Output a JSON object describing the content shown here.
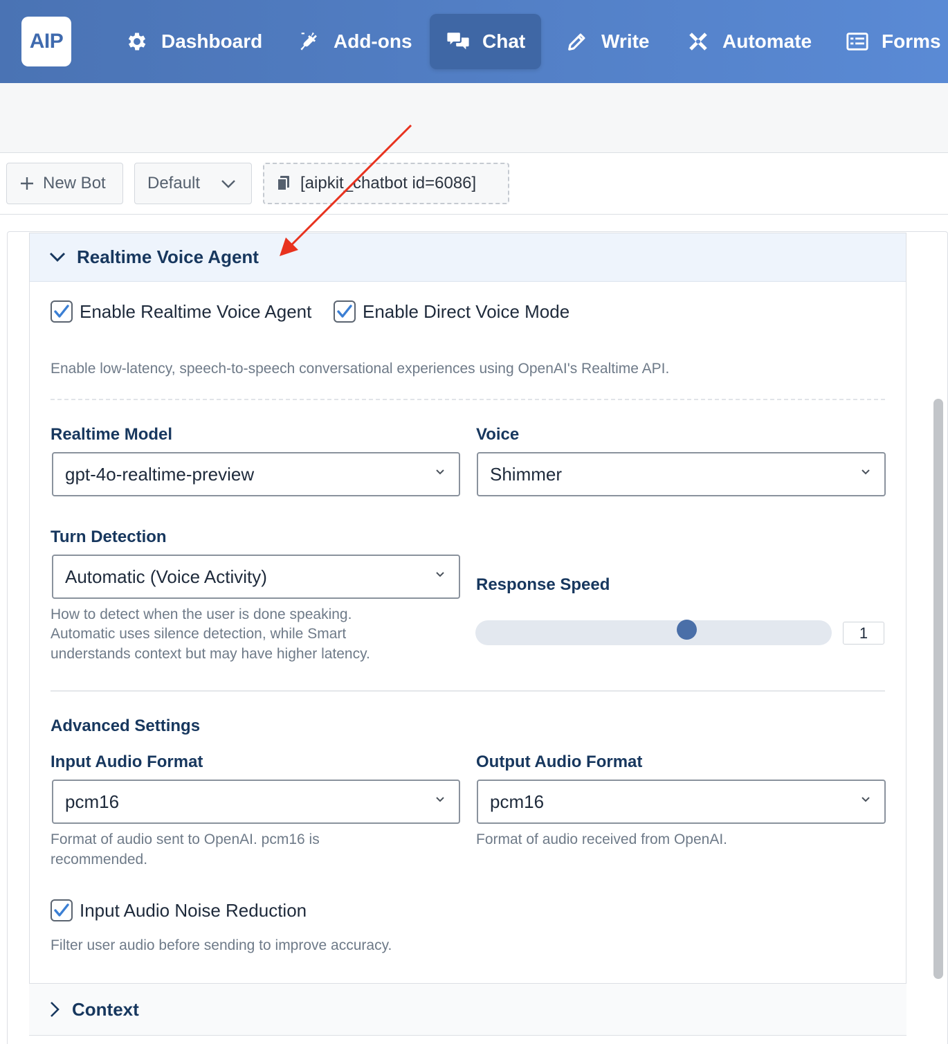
{
  "nav": {
    "logo": "AIP",
    "items": [
      {
        "label": "Dashboard",
        "icon": "gear-icon"
      },
      {
        "label": "Add-ons",
        "icon": "plug-icon"
      },
      {
        "label": "Chat",
        "icon": "chat-bubbles-icon",
        "active": true
      },
      {
        "label": "Write",
        "icon": "pencil-icon"
      },
      {
        "label": "Automate",
        "icon": "automate-icon"
      },
      {
        "label": "Forms",
        "icon": "form-icon"
      }
    ]
  },
  "toolbar": {
    "new_bot": "New Bot",
    "bot_select": "Default",
    "shortcode": "[aipkit_chatbot id=6086]"
  },
  "realtime": {
    "title": "Realtime Voice Agent",
    "enable_realtime_label": "Enable Realtime Voice Agent",
    "enable_realtime_checked": true,
    "enable_direct_label": "Enable Direct Voice Mode",
    "enable_direct_checked": true,
    "description": "Enable low-latency, speech-to-speech conversational experiences using OpenAI's Realtime API.",
    "model_label": "Realtime Model",
    "model_value": "gpt-4o-realtime-preview",
    "voice_label": "Voice",
    "voice_value": "Shimmer",
    "turn_label": "Turn Detection",
    "turn_value": "Automatic (Voice Activity)",
    "turn_help_1": "How to detect when the user is done speaking.",
    "turn_help_2": "Automatic uses silence detection, while Smart",
    "turn_help_3": "understands context but may have higher latency.",
    "speed_label": "Response Speed",
    "speed_value": "1",
    "advanced_label": "Advanced Settings",
    "input_format_label": "Input Audio Format",
    "input_format_value": "pcm16",
    "input_format_help_1": "Format of audio sent to OpenAI. pcm16 is",
    "input_format_help_2": "recommended.",
    "output_format_label": "Output Audio Format",
    "output_format_value": "pcm16",
    "output_format_help": "Format of audio received from OpenAI.",
    "noise_label": "Input Audio Noise Reduction",
    "noise_checked": true,
    "noise_help": "Filter user audio before sending to improve accuracy."
  },
  "context": {
    "title": "Context"
  },
  "colors": {
    "nav_start": "#4a73b4",
    "nav_end": "#5a8ad5",
    "heading": "#17375e",
    "checkbox_check": "#3b7fd4",
    "annotation_arrow": "#e8321e"
  }
}
